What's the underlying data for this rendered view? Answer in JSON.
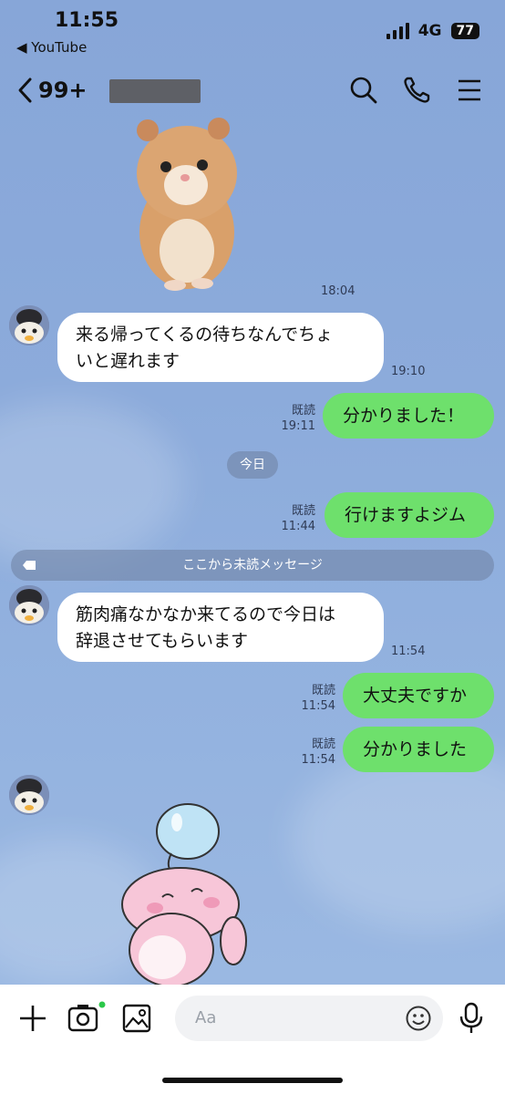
{
  "status_bar": {
    "time": "11:55",
    "back_app": "◀ YouTube",
    "network": "4G",
    "battery": "77"
  },
  "header": {
    "back_count": "99+"
  },
  "messages": [
    {
      "text": "来る帰ってくるの待ちなんでちょ\nいと遅れます",
      "time": "19:10"
    },
    {
      "read": "既読",
      "time": "19:11",
      "text": "分かりました！"
    },
    {
      "date_separator": "今日"
    },
    {
      "read": "既読",
      "time": "11:44",
      "text": "行けますよジム"
    },
    {
      "unread_separator": "ここから未読メッセージ"
    },
    {
      "text": "筋肉痛なかなか来てるので今日は\n辞退させてもらいます",
      "time": "11:54"
    },
    {
      "read": "既読",
      "time": "11:54",
      "text": "大丈夫ですか"
    },
    {
      "read": "既読",
      "time": "11:54",
      "text": "分かりました"
    }
  ],
  "stickers": {
    "hamster_time": "18:04"
  },
  "input": {
    "placeholder": "Aa"
  },
  "colors": {
    "outgoing_bubble": "#6ee06c",
    "incoming_bubble": "#ffffff",
    "chat_background": "#8aaad8"
  }
}
